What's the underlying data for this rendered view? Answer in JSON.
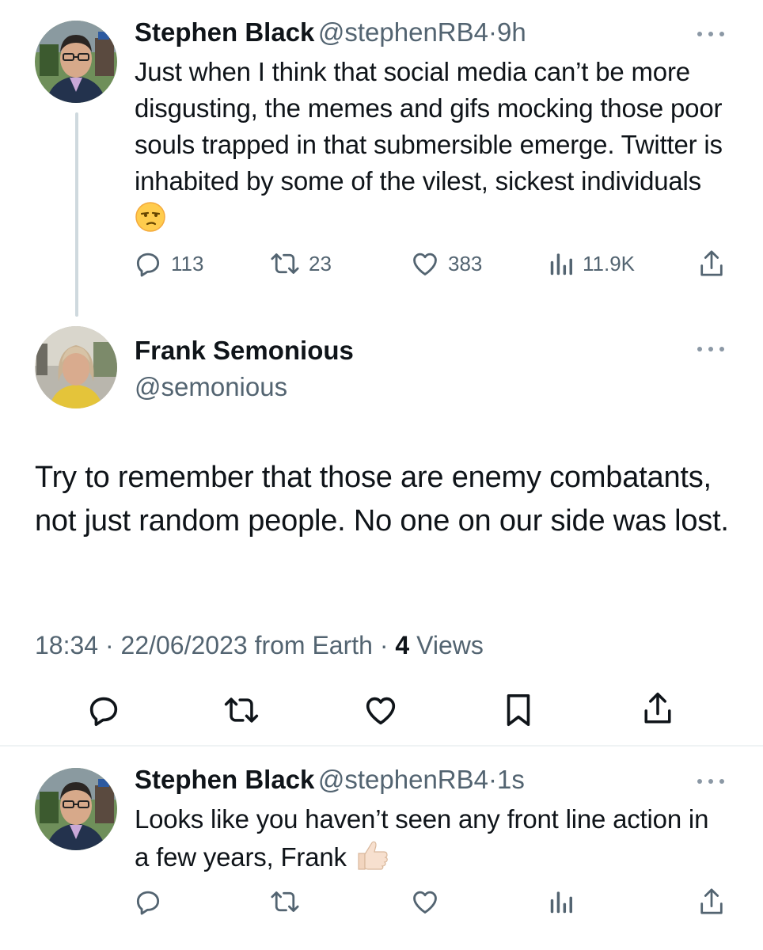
{
  "tweet1": {
    "name": "Stephen Black",
    "handle": "@stephenRB4",
    "separator": "·",
    "time": "9h",
    "text": "Just when I think that social media can’t be more disgusting, the memes and gifs mocking those poor souls trapped in that submersible emerge. Twitter is inhabited by some of the vilest, sickest individuals",
    "emoji": "unamused-face-emoji",
    "replies": "113",
    "retweets": "23",
    "likes": "383",
    "views": "11.9K"
  },
  "tweet2": {
    "name": "Frank Semonious",
    "handle": "@semonious",
    "text": "Try to remember that those are enemy combatants, not just random people. No one on our side was lost.",
    "time": "18:34",
    "separator": "·",
    "date": "22/06/2023",
    "source": "from Earth",
    "views_count": "4",
    "views_label": "Views"
  },
  "tweet3": {
    "name": "Stephen Black",
    "handle": "@stephenRB4",
    "separator": "·",
    "time": "1s",
    "text": "Looks like you haven’t seen any front line action in a few years, Frank",
    "emoji": "thumbs-up-emoji"
  },
  "colors": {
    "text_primary": "#0f1419",
    "text_secondary": "#536471",
    "thread_line": "#cfd9de",
    "divider": "#eff3f4"
  }
}
